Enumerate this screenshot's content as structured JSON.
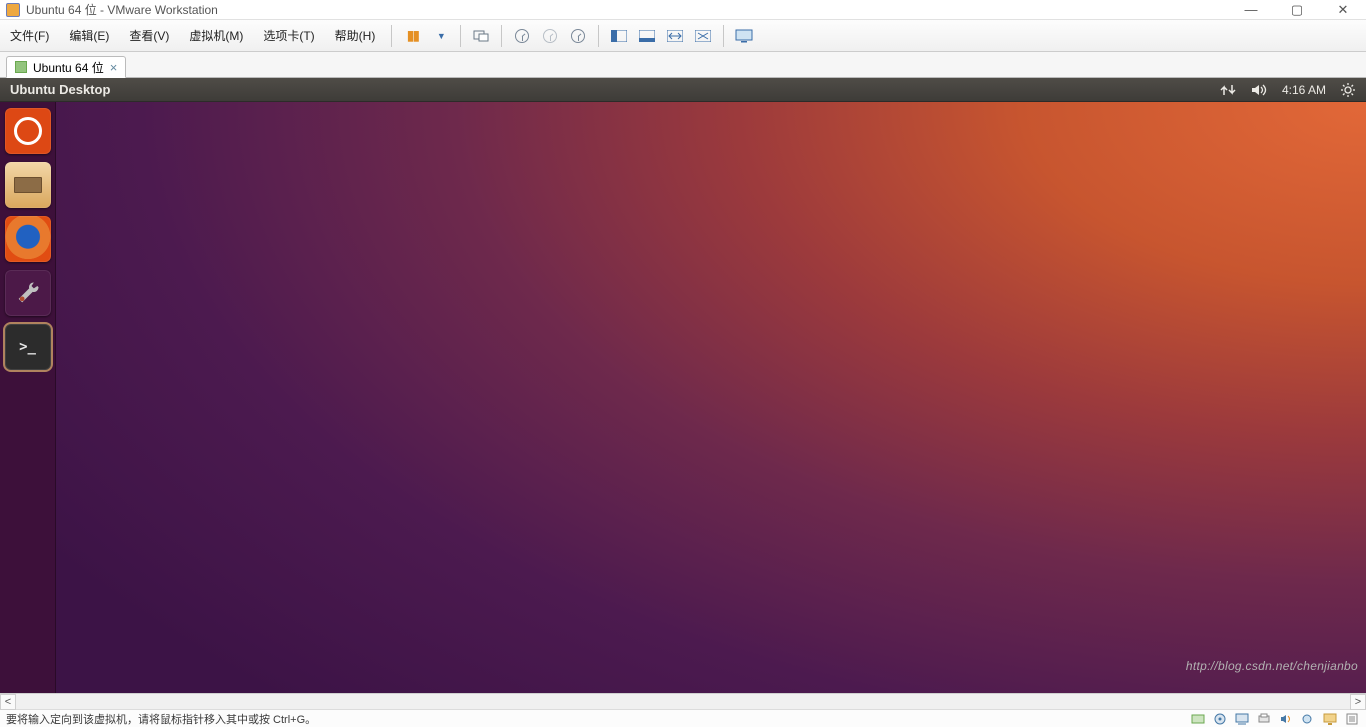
{
  "window": {
    "title": "Ubuntu 64 位 - VMware Workstation"
  },
  "menu": {
    "file": "文件(F)",
    "edit": "编辑(E)",
    "view": "查看(V)",
    "vm": "虚拟机(M)",
    "tabs": "选项卡(T)",
    "help": "帮助(H)"
  },
  "toolbar": {
    "pause_icon": "pause",
    "dropdown_icon": "caret-down",
    "devices_icon": "devices",
    "snapshot_icon": "clock",
    "snapshot_back_icon": "clock-back",
    "snapshot_fwd_icon": "clock-fwd",
    "unity_icon": "split-pane",
    "fullscreen1_icon": "window",
    "fullscreen2_icon": "expand",
    "fullscreen3_icon": "shrink",
    "fullscreen4_icon": "monitor"
  },
  "tab": {
    "label": "Ubuntu 64 位",
    "close_glyph": "×"
  },
  "guest": {
    "topbar_title": "Ubuntu Desktop",
    "clock": "4:16 AM",
    "indicators": {
      "network": "network-updown",
      "sound": "volume",
      "power": "gear"
    },
    "launcher": [
      {
        "name": "dash",
        "label": "Dash"
      },
      {
        "name": "files",
        "label": "Files"
      },
      {
        "name": "firefox",
        "label": "Firefox"
      },
      {
        "name": "settings",
        "label": "System Settings"
      },
      {
        "name": "terminal",
        "label": "Terminal"
      }
    ]
  },
  "statusbar": {
    "hint": "要将输入定向到该虚拟机，请将鼠标指针移入其中或按 Ctrl+G。",
    "watermark": "http://blog.csdn.net/chenjianbo"
  }
}
